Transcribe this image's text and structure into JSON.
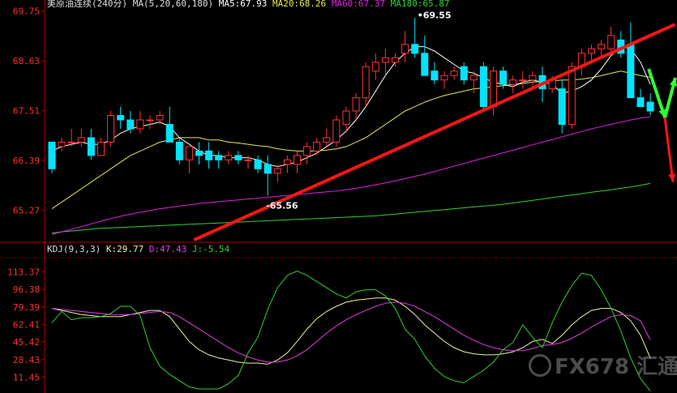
{
  "main_header": {
    "title": "美原油连续(240分)",
    "ma_params": "MA(5,20,60,180)",
    "ma5": "MA5:67.93",
    "ma20": "MA20:68.26",
    "ma60": "MA60:67.37",
    "ma180": "MA180:65.87"
  },
  "kdj_header": {
    "name": "KDJ(9,3,3)",
    "k": "K:29.77",
    "d": "D:47.43",
    "j": "J:-5.54"
  },
  "watermark": {
    "text": "FX678",
    "sub": "汇通"
  },
  "colors": {
    "up": "#ff3232",
    "down": "#00e4ff",
    "ma5": "#ffffff",
    "ma20": "#e8e850",
    "ma60": "#e020e0",
    "ma180": "#30d030",
    "trend": "#ff1414",
    "arrow_up": "#30ff30",
    "k": "#f0f0a0",
    "d": "#e040e0",
    "j": "#30d030",
    "axis": "#b00000",
    "label": "#ff3030"
  },
  "chart_data": [
    {
      "type": "candlestick",
      "title": "美原油连续(240分)",
      "y_ticks": [
        69.75,
        68.63,
        67.51,
        66.39,
        65.27
      ],
      "ylim": [
        64.6,
        70.0
      ],
      "annotations": [
        {
          "text": "69.55",
          "value": 69.55
        },
        {
          "text": "65.56",
          "value": 65.56
        }
      ],
      "candles": [
        [
          66.8,
          66.7,
          66.1,
          66.2
        ],
        [
          66.7,
          66.9,
          66.6,
          66.8
        ],
        [
          66.8,
          67.1,
          66.7,
          66.8
        ],
        [
          66.8,
          67.1,
          66.7,
          66.9
        ],
        [
          66.9,
          67.1,
          66.4,
          66.5
        ],
        [
          66.5,
          66.9,
          66.5,
          66.8
        ],
        [
          66.8,
          67.5,
          66.7,
          67.4
        ],
        [
          67.4,
          67.6,
          67.1,
          67.3
        ],
        [
          67.3,
          67.5,
          67.0,
          67.1
        ],
        [
          67.1,
          67.5,
          67.0,
          67.3
        ],
        [
          67.3,
          67.4,
          67.1,
          67.3
        ],
        [
          67.3,
          67.5,
          67.2,
          67.4
        ],
        [
          67.2,
          67.6,
          66.8,
          66.8
        ],
        [
          66.8,
          66.9,
          66.3,
          66.4
        ],
        [
          66.4,
          66.7,
          66.1,
          66.7
        ],
        [
          66.6,
          66.8,
          66.3,
          66.5
        ],
        [
          66.6,
          66.8,
          66.2,
          66.4
        ],
        [
          66.5,
          66.6,
          66.2,
          66.4
        ],
        [
          66.4,
          66.6,
          66.3,
          66.5
        ],
        [
          66.5,
          66.6,
          66.3,
          66.4
        ],
        [
          66.4,
          66.5,
          66.2,
          66.4
        ],
        [
          66.4,
          66.5,
          66.1,
          66.2
        ],
        [
          66.3,
          66.5,
          65.6,
          66.1
        ],
        [
          66.1,
          66.3,
          65.9,
          66.2
        ],
        [
          66.3,
          66.5,
          66.1,
          66.4
        ],
        [
          66.3,
          66.6,
          66.1,
          66.5
        ],
        [
          66.5,
          66.8,
          66.3,
          66.7
        ],
        [
          66.6,
          66.9,
          66.5,
          66.8
        ],
        [
          66.8,
          67.1,
          66.7,
          66.9
        ],
        [
          66.8,
          67.4,
          66.7,
          67.3
        ],
        [
          67.2,
          67.6,
          67.0,
          67.5
        ],
        [
          67.5,
          67.9,
          67.3,
          67.8
        ],
        [
          67.8,
          68.6,
          67.6,
          68.5
        ],
        [
          68.4,
          68.8,
          68.2,
          68.6
        ],
        [
          68.6,
          68.9,
          68.3,
          68.7
        ],
        [
          68.6,
          68.8,
          68.5,
          68.7
        ],
        [
          68.8,
          69.3,
          68.6,
          69.0
        ],
        [
          69.0,
          69.6,
          68.7,
          68.8
        ],
        [
          68.8,
          69.2,
          68.5,
          68.3
        ],
        [
          68.4,
          68.6,
          68.1,
          68.2
        ],
        [
          68.2,
          68.4,
          68.0,
          68.3
        ],
        [
          68.3,
          68.5,
          68.2,
          68.4
        ],
        [
          68.5,
          68.6,
          68.1,
          68.2
        ],
        [
          68.2,
          68.4,
          67.9,
          68.3
        ],
        [
          68.5,
          68.6,
          67.5,
          67.6
        ],
        [
          67.6,
          68.5,
          67.4,
          68.4
        ],
        [
          68.4,
          68.5,
          68.0,
          68.1
        ],
        [
          68.1,
          68.3,
          67.9,
          68.2
        ],
        [
          68.2,
          68.4,
          68.0,
          68.2
        ],
        [
          68.2,
          68.4,
          68.0,
          68.3
        ],
        [
          68.3,
          68.5,
          67.7,
          68.0
        ],
        [
          68.0,
          68.3,
          67.9,
          68.2
        ],
        [
          68.0,
          68.2,
          67.0,
          67.2
        ],
        [
          67.2,
          68.6,
          67.1,
          68.5
        ],
        [
          68.5,
          68.9,
          68.3,
          68.8
        ],
        [
          68.8,
          69.0,
          68.6,
          68.9
        ],
        [
          68.9,
          69.1,
          68.7,
          69.0
        ],
        [
          68.9,
          69.4,
          68.8,
          69.2
        ],
        [
          69.1,
          69.3,
          68.7,
          68.8
        ],
        [
          69.0,
          69.5,
          68.6,
          67.8
        ],
        [
          67.8,
          68.0,
          67.6,
          67.6
        ],
        [
          67.7,
          67.9,
          67.4,
          67.5
        ]
      ],
      "ma5": [
        66.6,
        66.7,
        66.75,
        66.8,
        66.75,
        66.75,
        66.85,
        67.0,
        67.1,
        67.15,
        67.2,
        67.25,
        67.15,
        66.9,
        66.75,
        66.6,
        66.5,
        66.5,
        66.45,
        66.45,
        66.45,
        66.4,
        66.3,
        66.25,
        66.3,
        66.35,
        66.45,
        66.55,
        66.7,
        66.85,
        67.05,
        67.3,
        67.6,
        67.95,
        68.3,
        68.6,
        68.8,
        68.95,
        68.95,
        68.85,
        68.7,
        68.55,
        68.4,
        68.35,
        68.25,
        68.15,
        68.1,
        68.05,
        68.15,
        68.2,
        68.15,
        68.1,
        67.9,
        67.95,
        68.05,
        68.2,
        68.45,
        68.75,
        68.95,
        68.9,
        68.6,
        68.1
      ],
      "ma20": [
        65.3,
        65.45,
        65.6,
        65.75,
        65.9,
        66.05,
        66.2,
        66.35,
        66.5,
        66.6,
        66.7,
        66.8,
        66.85,
        66.9,
        66.9,
        66.9,
        66.85,
        66.85,
        66.8,
        66.78,
        66.75,
        66.72,
        66.7,
        66.65,
        66.62,
        66.6,
        66.6,
        66.6,
        66.62,
        66.65,
        66.7,
        66.8,
        66.9,
        67.05,
        67.2,
        67.35,
        67.5,
        67.6,
        67.7,
        67.78,
        67.85,
        67.9,
        67.95,
        68.0,
        68.02,
        68.05,
        68.07,
        68.1,
        68.12,
        68.15,
        68.17,
        68.18,
        68.2,
        68.2,
        68.22,
        68.25,
        68.3,
        68.35,
        68.4,
        68.35,
        68.3,
        68.26
      ],
      "ma60": [
        64.72,
        64.78,
        64.84,
        64.9,
        64.96,
        65.02,
        65.08,
        65.13,
        65.18,
        65.22,
        65.26,
        65.3,
        65.33,
        65.36,
        65.39,
        65.42,
        65.44,
        65.46,
        65.48,
        65.5,
        65.52,
        65.54,
        65.56,
        65.58,
        65.6,
        65.62,
        65.64,
        65.66,
        65.68,
        65.7,
        65.73,
        65.76,
        65.8,
        65.84,
        65.88,
        65.93,
        65.98,
        66.03,
        66.08,
        66.14,
        66.2,
        66.26,
        66.32,
        66.38,
        66.44,
        66.5,
        66.56,
        66.62,
        66.68,
        66.74,
        66.8,
        66.86,
        66.92,
        66.98,
        67.04,
        67.1,
        67.15,
        67.2,
        67.25,
        67.3,
        67.34,
        67.37
      ],
      "ma180": [
        64.75,
        64.78,
        64.8,
        64.82,
        64.84,
        64.86,
        64.87,
        64.88,
        64.89,
        64.9,
        64.91,
        64.92,
        64.93,
        64.94,
        64.95,
        64.96,
        64.97,
        64.98,
        64.99,
        65.0,
        65.01,
        65.02,
        65.03,
        65.04,
        65.05,
        65.06,
        65.07,
        65.08,
        65.09,
        65.1,
        65.11,
        65.12,
        65.13,
        65.14,
        65.16,
        65.18,
        65.2,
        65.22,
        65.24,
        65.26,
        65.28,
        65.3,
        65.32,
        65.34,
        65.36,
        65.38,
        65.4,
        65.43,
        65.46,
        65.49,
        65.52,
        65.55,
        65.58,
        65.61,
        65.64,
        65.67,
        65.7,
        65.73,
        65.76,
        65.79,
        65.83,
        65.87
      ],
      "trend_line": {
        "from": [
          14.5,
          64.6
        ],
        "to": [
          63.5,
          69.45
        ]
      }
    },
    {
      "type": "line",
      "title": "KDJ(9,3,3)",
      "y_ticks": [
        113.37,
        96.38,
        79.39,
        62.41,
        45.42,
        28.43,
        11.45
      ],
      "ylim": [
        0,
        120
      ],
      "series": [
        {
          "name": "K",
          "values": [
            78,
            76,
            74,
            72,
            71,
            70,
            70,
            70,
            72,
            74,
            76,
            76,
            70,
            58,
            46,
            38,
            33,
            30,
            28,
            26,
            25,
            25,
            24,
            28,
            35,
            46,
            58,
            68,
            75,
            80,
            84,
            86,
            87,
            88,
            88,
            86,
            80,
            72,
            62,
            54,
            46,
            40,
            36,
            34,
            33,
            33,
            34,
            36,
            40,
            46,
            48,
            44,
            52,
            62,
            70,
            76,
            78,
            78,
            74,
            66,
            52,
            29.77
          ]
        },
        {
          "name": "D",
          "values": [
            78,
            77,
            76,
            75,
            74,
            73,
            72,
            72,
            72,
            73,
            74,
            75,
            74,
            70,
            64,
            58,
            52,
            46,
            40,
            35,
            31,
            28,
            26,
            26,
            28,
            32,
            38,
            46,
            54,
            61,
            67,
            72,
            76,
            80,
            83,
            84,
            83,
            80,
            75,
            70,
            64,
            58,
            52,
            47,
            43,
            40,
            38,
            37,
            37,
            39,
            42,
            43,
            45,
            49,
            54,
            60,
            65,
            70,
            72,
            71,
            66,
            47.43
          ]
        },
        {
          "name": "J",
          "values": [
            64,
            75,
            67,
            69,
            69,
            70,
            73,
            80,
            80,
            71,
            40,
            22,
            14,
            8,
            2,
            0,
            0,
            0,
            5,
            13,
            35,
            50,
            77,
            98,
            110,
            114,
            110,
            104,
            98,
            92,
            88,
            94,
            96,
            96,
            90,
            78,
            58,
            48,
            32,
            20,
            12,
            8,
            6,
            12,
            18,
            26,
            38,
            45,
            62,
            50,
            40,
            64,
            84,
            100,
            112,
            110,
            96,
            78,
            56,
            30,
            10,
            -5.54
          ]
        }
      ]
    }
  ]
}
